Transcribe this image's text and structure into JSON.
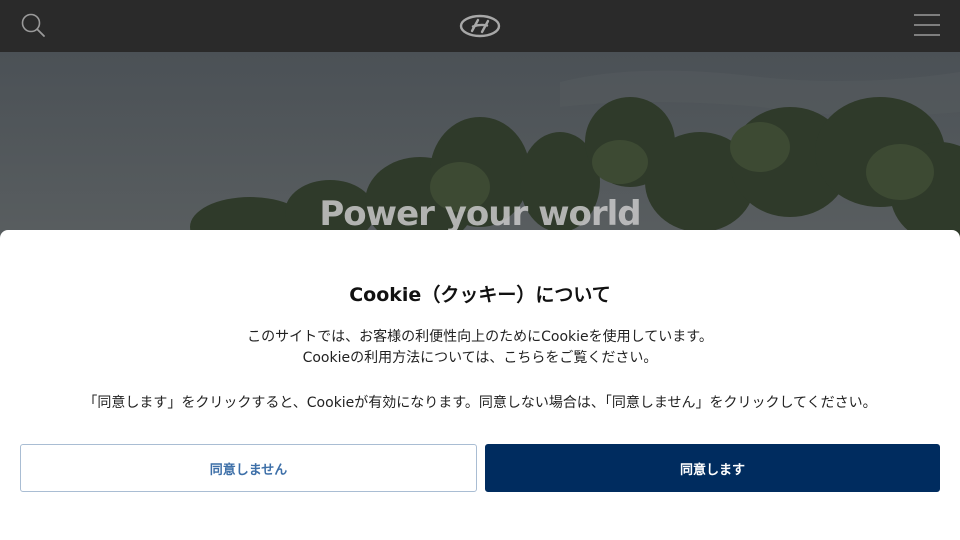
{
  "header": {
    "search_icon": "search-icon",
    "logo": "hyundai-logo",
    "menu_icon": "hamburger-menu-icon"
  },
  "hero": {
    "headline": "Power your world"
  },
  "cookie_notice": {
    "title": "Cookie（クッキー）について",
    "line1": "このサイトでは、お客様の利便性向上のためにCookieを使用しています。",
    "line2": "Cookieの利用方法については、こちらをご覧ください。",
    "line3": "「同意します」をクリックすると、Cookieが有効になります。同意しない場合は、「同意しません」をクリックしてください。",
    "decline_label": "同意しません",
    "accept_label": "同意します"
  },
  "colors": {
    "header_bg": "#2a2a2a",
    "accent": "#002c5f",
    "decline_text": "#3d6fa8",
    "decline_border": "#a9bdd3"
  }
}
